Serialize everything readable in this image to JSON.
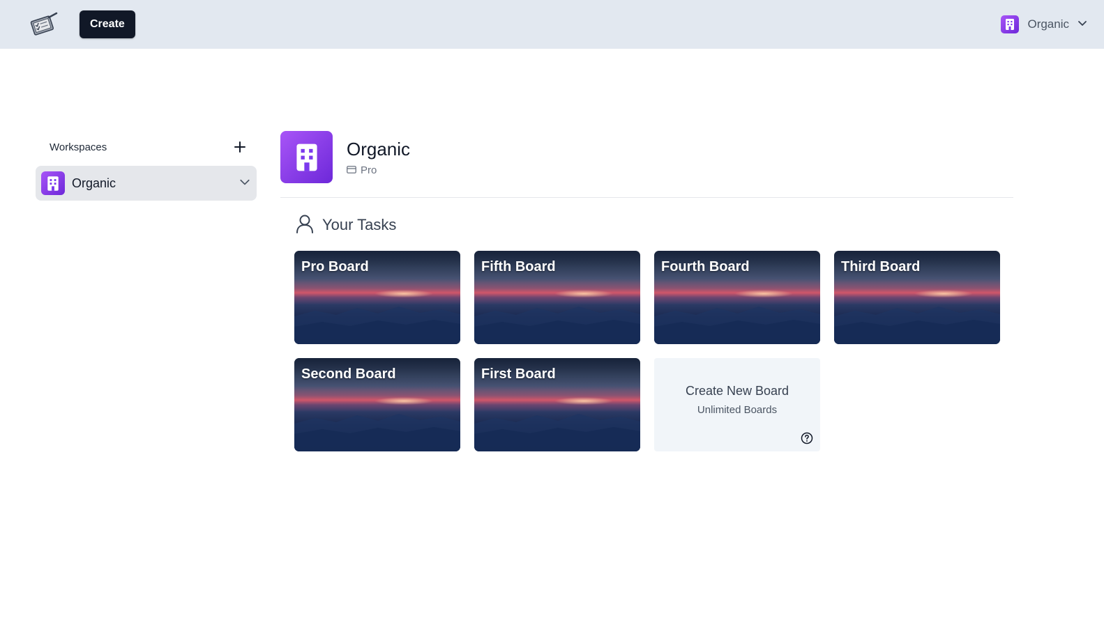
{
  "header": {
    "logo_icon": "checklist-clipboard-icon",
    "create_label": "Create",
    "workspace_name": "Organic",
    "workspace_icon": "building-icon",
    "chevron_icon": "chevron-down-icon"
  },
  "sidebar": {
    "title": "Workspaces",
    "add_icon": "plus-icon",
    "items": [
      {
        "label": "Organic",
        "icon": "building-icon",
        "expand_icon": "chevron-down-icon"
      }
    ]
  },
  "main": {
    "org_name": "Organic",
    "org_plan": "Pro",
    "plan_icon": "credit-card-icon",
    "tasks_title": "Your Tasks",
    "tasks_icon": "user-icon",
    "boards": [
      {
        "title": "Pro Board"
      },
      {
        "title": "Fifth Board"
      },
      {
        "title": "Fourth Board"
      },
      {
        "title": "Third Board"
      },
      {
        "title": "Second Board"
      },
      {
        "title": "First Board"
      }
    ],
    "new_board": {
      "title": "Create New Board",
      "subtitle": "Unlimited Boards",
      "help_icon": "question-circle-icon"
    }
  },
  "colors": {
    "topbar_bg": "#e2e8f0",
    "create_button_bg": "#111827",
    "org_icon_gradient_start": "#a855f7",
    "org_icon_gradient_end": "#6d28d9",
    "sidebar_item_bg": "#e5e7eb",
    "new_board_bg": "#f1f5f9"
  }
}
